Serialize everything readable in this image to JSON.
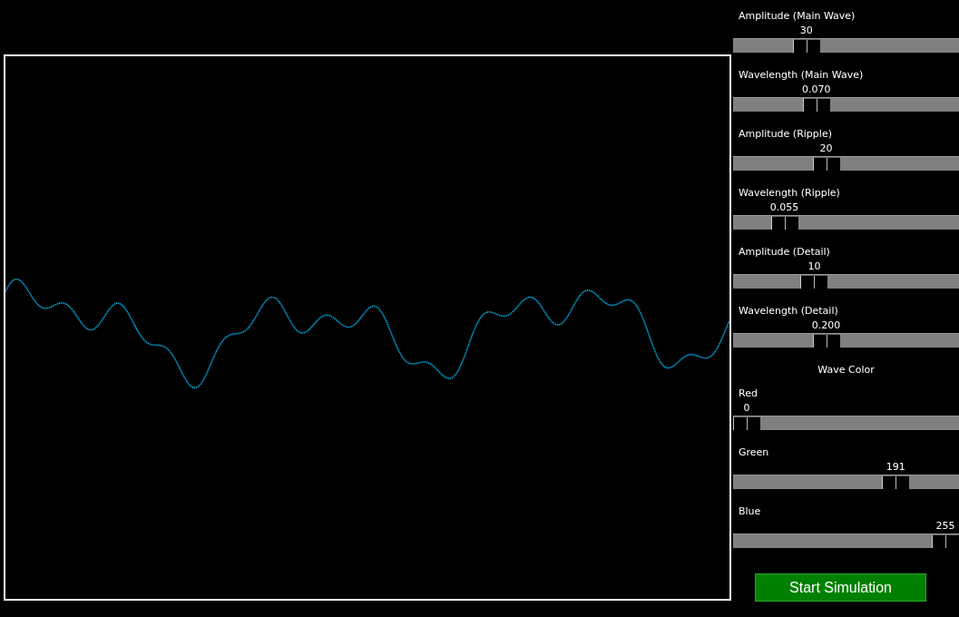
{
  "sliders": [
    {
      "label": "Amplitude (Main Wave)",
      "value": "30",
      "level": 0.3
    },
    {
      "label": "Wavelength (Main Wave)",
      "value": "0.070",
      "level": 0.35
    },
    {
      "label": "Amplitude (Ripple)",
      "value": "20",
      "level": 0.4
    },
    {
      "label": "Wavelength (Ripple)",
      "value": "0.055",
      "level": 0.19
    },
    {
      "label": "Amplitude (Detail)",
      "value": "10",
      "level": 0.34
    },
    {
      "label": "Wavelength (Detail)",
      "value": "0.200",
      "level": 0.4
    }
  ],
  "color_heading": "Wave Color",
  "color_sliders": [
    {
      "label": "Red",
      "value": "0",
      "level": 0
    },
    {
      "label": "Green",
      "value": "191",
      "level": 0.75
    },
    {
      "label": "Blue",
      "value": "255",
      "level": 1
    }
  ],
  "button": "Start Simulation"
}
